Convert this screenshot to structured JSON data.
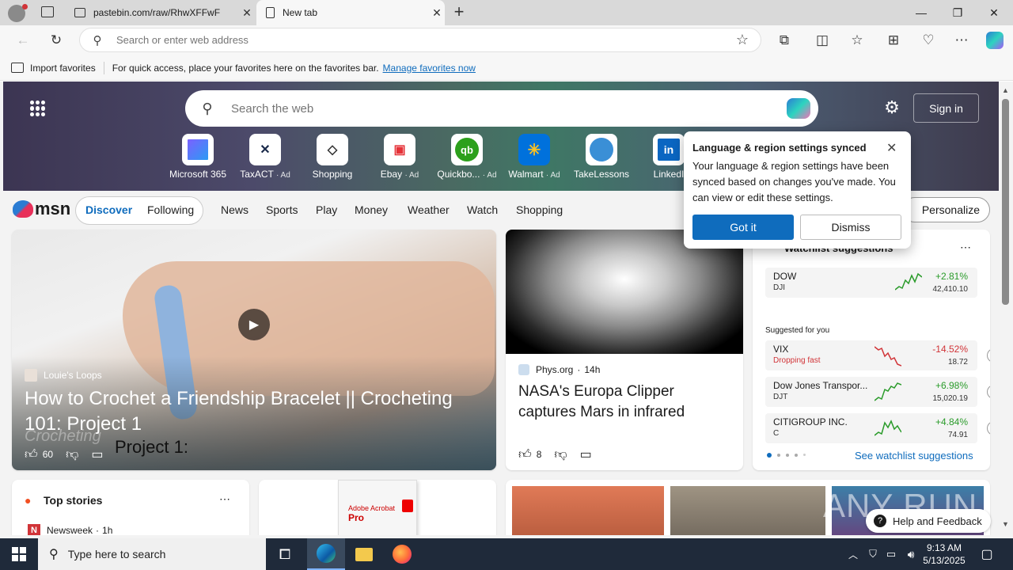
{
  "browser": {
    "tabs": [
      {
        "title": "pastebin.com/raw/RhwXFFwF",
        "active": false
      },
      {
        "title": "New tab",
        "active": true
      }
    ],
    "address_placeholder": "Search or enter web address"
  },
  "favorites_bar": {
    "import_label": "Import favorites",
    "hint": "For quick access, place your favorites here on the favorites bar.",
    "manage_link": "Manage favorites now"
  },
  "newtab": {
    "search_placeholder": "Search the web",
    "sign_in": "Sign in",
    "quick_links": [
      {
        "label": "Microsoft 365",
        "ad": "",
        "icon": "microsoft-365-icon"
      },
      {
        "label": "TaxACT",
        "ad": "· Ad",
        "icon": "taxact-icon"
      },
      {
        "label": "Shopping",
        "ad": "",
        "icon": "shopping-tag-icon"
      },
      {
        "label": "Ebay",
        "ad": "· Ad",
        "icon": "ebay-icon"
      },
      {
        "label": "Quickbo...",
        "ad": "· Ad",
        "icon": "quickbooks-icon"
      },
      {
        "label": "Walmart",
        "ad": "· Ad",
        "icon": "walmart-icon"
      },
      {
        "label": "TakeLessons",
        "ad": "",
        "icon": "takelessons-icon"
      },
      {
        "label": "LinkedI",
        "ad": "",
        "icon": "linkedin-icon"
      }
    ]
  },
  "msn": {
    "logo": "msn",
    "tabs": [
      "Discover",
      "Following"
    ],
    "nav": [
      "News",
      "Sports",
      "Play",
      "Money",
      "Weather",
      "Watch",
      "Shopping"
    ],
    "personalize": "Personalize"
  },
  "hero_card": {
    "source": "Louie's Loops",
    "title": "How to Crochet a Friendship Bracelet || Crocheting 101: Project 1",
    "likes": "60",
    "overlay_text": "Project 1:",
    "watermark": "Crocheting"
  },
  "news_card": {
    "source": "Phys.org",
    "time": "14h",
    "title": "NASA's Europa Clipper captures Mars in infrared",
    "likes": "8"
  },
  "watchlist": {
    "title": "Watchlist suggestions",
    "suggested_label": "Suggested for you",
    "see_more": "See watchlist suggestions",
    "main": {
      "name": "DOW",
      "symbol": "DJI",
      "change": "+2.81%",
      "price": "42,410.10"
    },
    "items": [
      {
        "name": "VIX",
        "symbol": "",
        "note": "Dropping fast",
        "change": "-14.52%",
        "price": "18.72",
        "up": false
      },
      {
        "name": "Dow Jones Transpor...",
        "symbol": "DJT",
        "note": "",
        "change": "+6.98%",
        "price": "15,020.19",
        "up": true
      },
      {
        "name": "CITIGROUP INC.",
        "symbol": "C",
        "note": "",
        "change": "+4.84%",
        "price": "74.91",
        "up": true
      }
    ]
  },
  "top_stories": {
    "title": "Top stories",
    "first_source": "Newsweek",
    "first_time": "1h"
  },
  "ad_card": {
    "product": "Adobe Acrobat",
    "product_line": "Pro"
  },
  "help": "Help and Feedback",
  "watermark": "ANY RUN",
  "popup": {
    "title": "Language & region settings synced",
    "body": "Your language & region settings have been synced based on changes you've made. You can view or edit these settings.",
    "primary": "Got it",
    "secondary": "Dismiss"
  },
  "taskbar": {
    "search_placeholder": "Type here to search",
    "time": "9:13 AM",
    "date": "5/13/2025"
  },
  "colors": {
    "accent": "#0f6cbd",
    "up": "#2a9b2a",
    "down": "#d13438"
  }
}
